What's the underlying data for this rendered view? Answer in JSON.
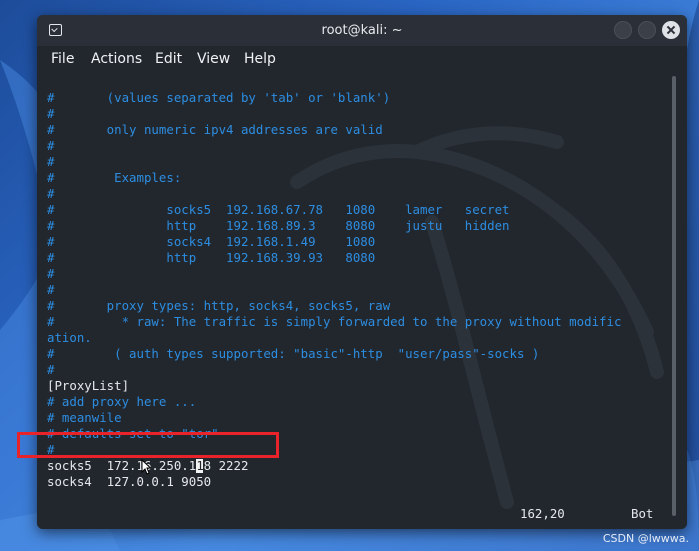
{
  "window": {
    "title": "root@kali: ~"
  },
  "menu": {
    "file": "File",
    "actions": "Actions",
    "edit": "Edit",
    "view": "View",
    "help": "Help"
  },
  "terminal": {
    "lines": [
      {
        "text": "#       (values separated by 'tab' or 'blank')",
        "type": "comment"
      },
      {
        "text": "#",
        "type": "comment"
      },
      {
        "text": "#       only numeric ipv4 addresses are valid",
        "type": "comment"
      },
      {
        "text": "#",
        "type": "comment"
      },
      {
        "text": "#",
        "type": "comment"
      },
      {
        "text": "#        Examples:",
        "type": "comment"
      },
      {
        "text": "#",
        "type": "comment"
      },
      {
        "text": "#               socks5  192.168.67.78   1080    lamer   secret",
        "type": "comment"
      },
      {
        "text": "#               http    192.168.89.3    8080    justu   hidden",
        "type": "comment"
      },
      {
        "text": "#               socks4  192.168.1.49    1080",
        "type": "comment"
      },
      {
        "text": "#               http    192.168.39.93   8080",
        "type": "comment"
      },
      {
        "text": "#",
        "type": "comment"
      },
      {
        "text": "#",
        "type": "comment"
      },
      {
        "text": "#       proxy types: http, socks4, socks5, raw",
        "type": "comment"
      },
      {
        "text": "#         * raw: The traffic is simply forwarded to the proxy without modific",
        "type": "comment"
      },
      {
        "text": "ation.",
        "type": "comment"
      },
      {
        "text": "#        ( auth types supported: \"basic\"-http  \"user/pass\"-socks )",
        "type": "comment"
      },
      {
        "text": "#",
        "type": "comment"
      },
      {
        "text": "[ProxyList]",
        "type": "text"
      },
      {
        "text": "# add proxy here ...",
        "type": "comment"
      },
      {
        "text": "# meanwile",
        "type": "comment"
      },
      {
        "text": "# defaults set to \"tor\"",
        "type": "comment"
      },
      {
        "text": "#",
        "type": "comment"
      },
      {
        "text": "socks5  172.16.250.128 2222",
        "type": "text"
      },
      {
        "text": "socks4  127.0.0.1 9050",
        "type": "text"
      }
    ],
    "cursor_char": "1",
    "status_position": "162,20",
    "status_scroll": "Bot"
  },
  "watermark": "CSDN @lwwwa.",
  "colors": {
    "comment": "#2d8de0",
    "text": "#e6e8eb",
    "highlight": "#e8242a",
    "terminal_bg": "#22272e"
  }
}
